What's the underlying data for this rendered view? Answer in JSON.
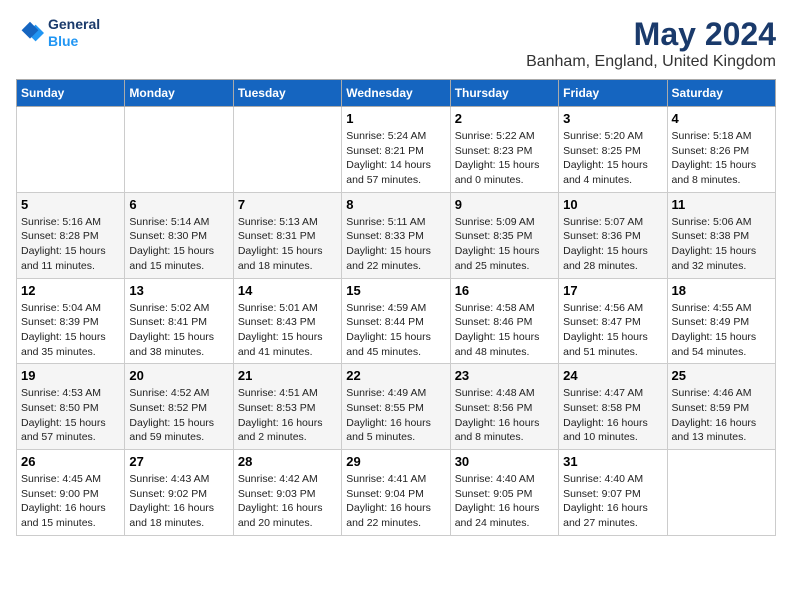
{
  "header": {
    "logo_line1": "General",
    "logo_line2": "Blue",
    "title": "May 2024",
    "subtitle": "Banham, England, United Kingdom"
  },
  "weekdays": [
    "Sunday",
    "Monday",
    "Tuesday",
    "Wednesday",
    "Thursday",
    "Friday",
    "Saturday"
  ],
  "weeks": [
    [
      {
        "day": "",
        "info": ""
      },
      {
        "day": "",
        "info": ""
      },
      {
        "day": "",
        "info": ""
      },
      {
        "day": "1",
        "info": "Sunrise: 5:24 AM\nSunset: 8:21 PM\nDaylight: 14 hours\nand 57 minutes."
      },
      {
        "day": "2",
        "info": "Sunrise: 5:22 AM\nSunset: 8:23 PM\nDaylight: 15 hours\nand 0 minutes."
      },
      {
        "day": "3",
        "info": "Sunrise: 5:20 AM\nSunset: 8:25 PM\nDaylight: 15 hours\nand 4 minutes."
      },
      {
        "day": "4",
        "info": "Sunrise: 5:18 AM\nSunset: 8:26 PM\nDaylight: 15 hours\nand 8 minutes."
      }
    ],
    [
      {
        "day": "5",
        "info": "Sunrise: 5:16 AM\nSunset: 8:28 PM\nDaylight: 15 hours\nand 11 minutes."
      },
      {
        "day": "6",
        "info": "Sunrise: 5:14 AM\nSunset: 8:30 PM\nDaylight: 15 hours\nand 15 minutes."
      },
      {
        "day": "7",
        "info": "Sunrise: 5:13 AM\nSunset: 8:31 PM\nDaylight: 15 hours\nand 18 minutes."
      },
      {
        "day": "8",
        "info": "Sunrise: 5:11 AM\nSunset: 8:33 PM\nDaylight: 15 hours\nand 22 minutes."
      },
      {
        "day": "9",
        "info": "Sunrise: 5:09 AM\nSunset: 8:35 PM\nDaylight: 15 hours\nand 25 minutes."
      },
      {
        "day": "10",
        "info": "Sunrise: 5:07 AM\nSunset: 8:36 PM\nDaylight: 15 hours\nand 28 minutes."
      },
      {
        "day": "11",
        "info": "Sunrise: 5:06 AM\nSunset: 8:38 PM\nDaylight: 15 hours\nand 32 minutes."
      }
    ],
    [
      {
        "day": "12",
        "info": "Sunrise: 5:04 AM\nSunset: 8:39 PM\nDaylight: 15 hours\nand 35 minutes."
      },
      {
        "day": "13",
        "info": "Sunrise: 5:02 AM\nSunset: 8:41 PM\nDaylight: 15 hours\nand 38 minutes."
      },
      {
        "day": "14",
        "info": "Sunrise: 5:01 AM\nSunset: 8:43 PM\nDaylight: 15 hours\nand 41 minutes."
      },
      {
        "day": "15",
        "info": "Sunrise: 4:59 AM\nSunset: 8:44 PM\nDaylight: 15 hours\nand 45 minutes."
      },
      {
        "day": "16",
        "info": "Sunrise: 4:58 AM\nSunset: 8:46 PM\nDaylight: 15 hours\nand 48 minutes."
      },
      {
        "day": "17",
        "info": "Sunrise: 4:56 AM\nSunset: 8:47 PM\nDaylight: 15 hours\nand 51 minutes."
      },
      {
        "day": "18",
        "info": "Sunrise: 4:55 AM\nSunset: 8:49 PM\nDaylight: 15 hours\nand 54 minutes."
      }
    ],
    [
      {
        "day": "19",
        "info": "Sunrise: 4:53 AM\nSunset: 8:50 PM\nDaylight: 15 hours\nand 57 minutes."
      },
      {
        "day": "20",
        "info": "Sunrise: 4:52 AM\nSunset: 8:52 PM\nDaylight: 15 hours\nand 59 minutes."
      },
      {
        "day": "21",
        "info": "Sunrise: 4:51 AM\nSunset: 8:53 PM\nDaylight: 16 hours\nand 2 minutes."
      },
      {
        "day": "22",
        "info": "Sunrise: 4:49 AM\nSunset: 8:55 PM\nDaylight: 16 hours\nand 5 minutes."
      },
      {
        "day": "23",
        "info": "Sunrise: 4:48 AM\nSunset: 8:56 PM\nDaylight: 16 hours\nand 8 minutes."
      },
      {
        "day": "24",
        "info": "Sunrise: 4:47 AM\nSunset: 8:58 PM\nDaylight: 16 hours\nand 10 minutes."
      },
      {
        "day": "25",
        "info": "Sunrise: 4:46 AM\nSunset: 8:59 PM\nDaylight: 16 hours\nand 13 minutes."
      }
    ],
    [
      {
        "day": "26",
        "info": "Sunrise: 4:45 AM\nSunset: 9:00 PM\nDaylight: 16 hours\nand 15 minutes."
      },
      {
        "day": "27",
        "info": "Sunrise: 4:43 AM\nSunset: 9:02 PM\nDaylight: 16 hours\nand 18 minutes."
      },
      {
        "day": "28",
        "info": "Sunrise: 4:42 AM\nSunset: 9:03 PM\nDaylight: 16 hours\nand 20 minutes."
      },
      {
        "day": "29",
        "info": "Sunrise: 4:41 AM\nSunset: 9:04 PM\nDaylight: 16 hours\nand 22 minutes."
      },
      {
        "day": "30",
        "info": "Sunrise: 4:40 AM\nSunset: 9:05 PM\nDaylight: 16 hours\nand 24 minutes."
      },
      {
        "day": "31",
        "info": "Sunrise: 4:40 AM\nSunset: 9:07 PM\nDaylight: 16 hours\nand 27 minutes."
      },
      {
        "day": "",
        "info": ""
      }
    ]
  ]
}
